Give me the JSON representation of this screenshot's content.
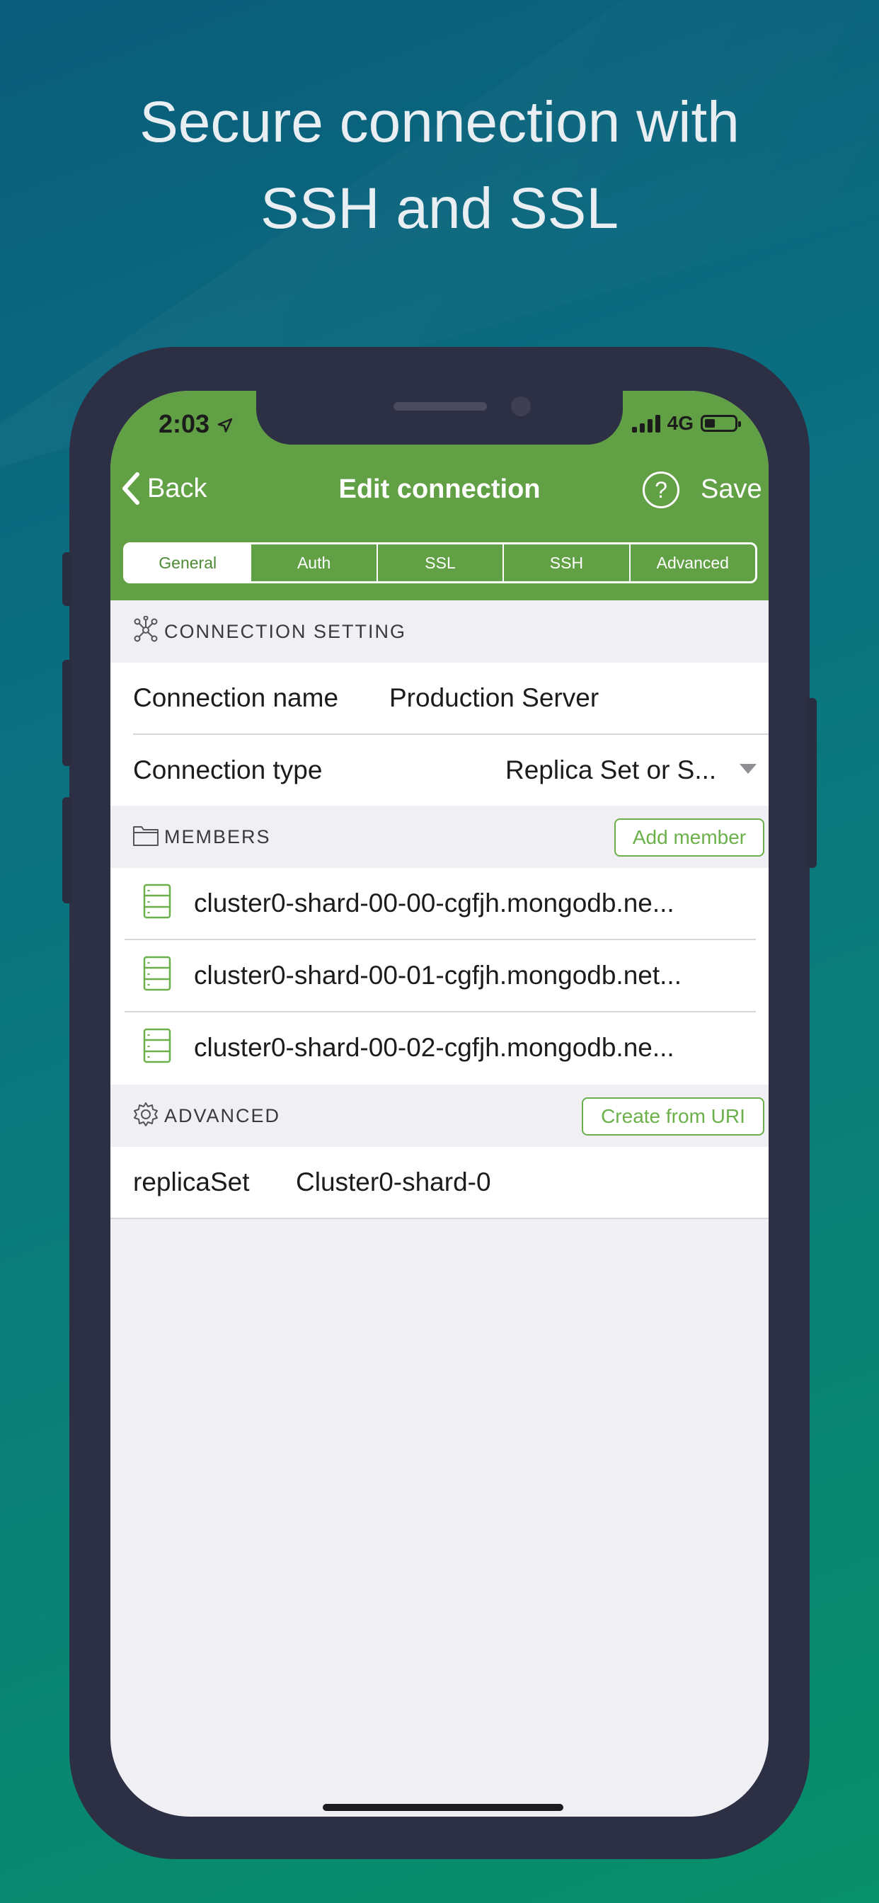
{
  "headline": {
    "line1": "Secure connection with",
    "line2": "SSH and SSL"
  },
  "status_bar": {
    "time": "2:03",
    "network": "4G"
  },
  "nav": {
    "back_label": "Back",
    "title": "Edit connection",
    "help_glyph": "?",
    "save_label": "Save"
  },
  "tabs": [
    "General",
    "Auth",
    "SSL",
    "SSH",
    "Advanced"
  ],
  "connection_setting": {
    "header": "CONNECTION SETTING",
    "name_label": "Connection name",
    "name_value": "Production Server",
    "type_label": "Connection type",
    "type_value": "Replica Set or S..."
  },
  "members": {
    "header": "MEMBERS",
    "add_button": "Add member",
    "items": [
      "cluster0-shard-00-00-cgfjh.mongodb.ne...",
      "cluster0-shard-00-01-cgfjh.mongodb.net...",
      "cluster0-shard-00-02-cgfjh.mongodb.ne..."
    ]
  },
  "advanced": {
    "header": "ADVANCED",
    "create_button": "Create from URI",
    "key": "replicaSet",
    "value": "Cluster0-shard-0"
  },
  "colors": {
    "accent_green": "#62a045",
    "button_green": "#6bb04a",
    "phone_frame": "#2d2f45"
  }
}
